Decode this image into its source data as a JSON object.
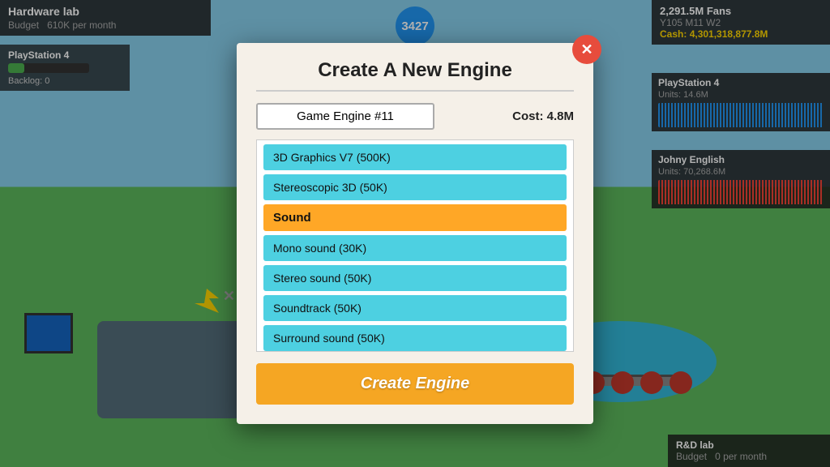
{
  "game": {
    "score": "3427",
    "hardware_lab": {
      "title": "Hardware lab",
      "budget_label": "Budget",
      "budget_value": "610K per month"
    },
    "console": {
      "name": "PlayStation 4",
      "backlog": "Backlog: 0"
    },
    "stats": {
      "fans": "2,291.5M Fans",
      "date": "Y105 M11 W2",
      "cash_label": "Cash:",
      "cash": "4,301,318,877.8M"
    },
    "ps4_mini": {
      "name": "PlayStation 4",
      "units": "Units: 14.6M"
    },
    "johny_mini": {
      "name": "Johny English",
      "units": "Units: 70,268.6M"
    },
    "rnd_lab": {
      "title": "R&D lab",
      "budget_label": "Budget",
      "budget_value": "0 per month"
    }
  },
  "modal": {
    "title": "Create A New Engine",
    "close_icon": "✕",
    "engine_name": "Game Engine #11",
    "cost_label": "Cost: 4.8M",
    "features": [
      {
        "label": "3D Graphics V7 (500K)",
        "type": "item"
      },
      {
        "label": "Stereoscopic 3D (50K)",
        "type": "item"
      },
      {
        "label": "Sound",
        "type": "section"
      },
      {
        "label": "Mono sound (30K)",
        "type": "item"
      },
      {
        "label": "Stereo sound (50K)",
        "type": "item"
      },
      {
        "label": "Soundtrack (50K)",
        "type": "item"
      },
      {
        "label": "Surround sound (50K)",
        "type": "item"
      }
    ],
    "create_button_label": "Create Engine"
  }
}
